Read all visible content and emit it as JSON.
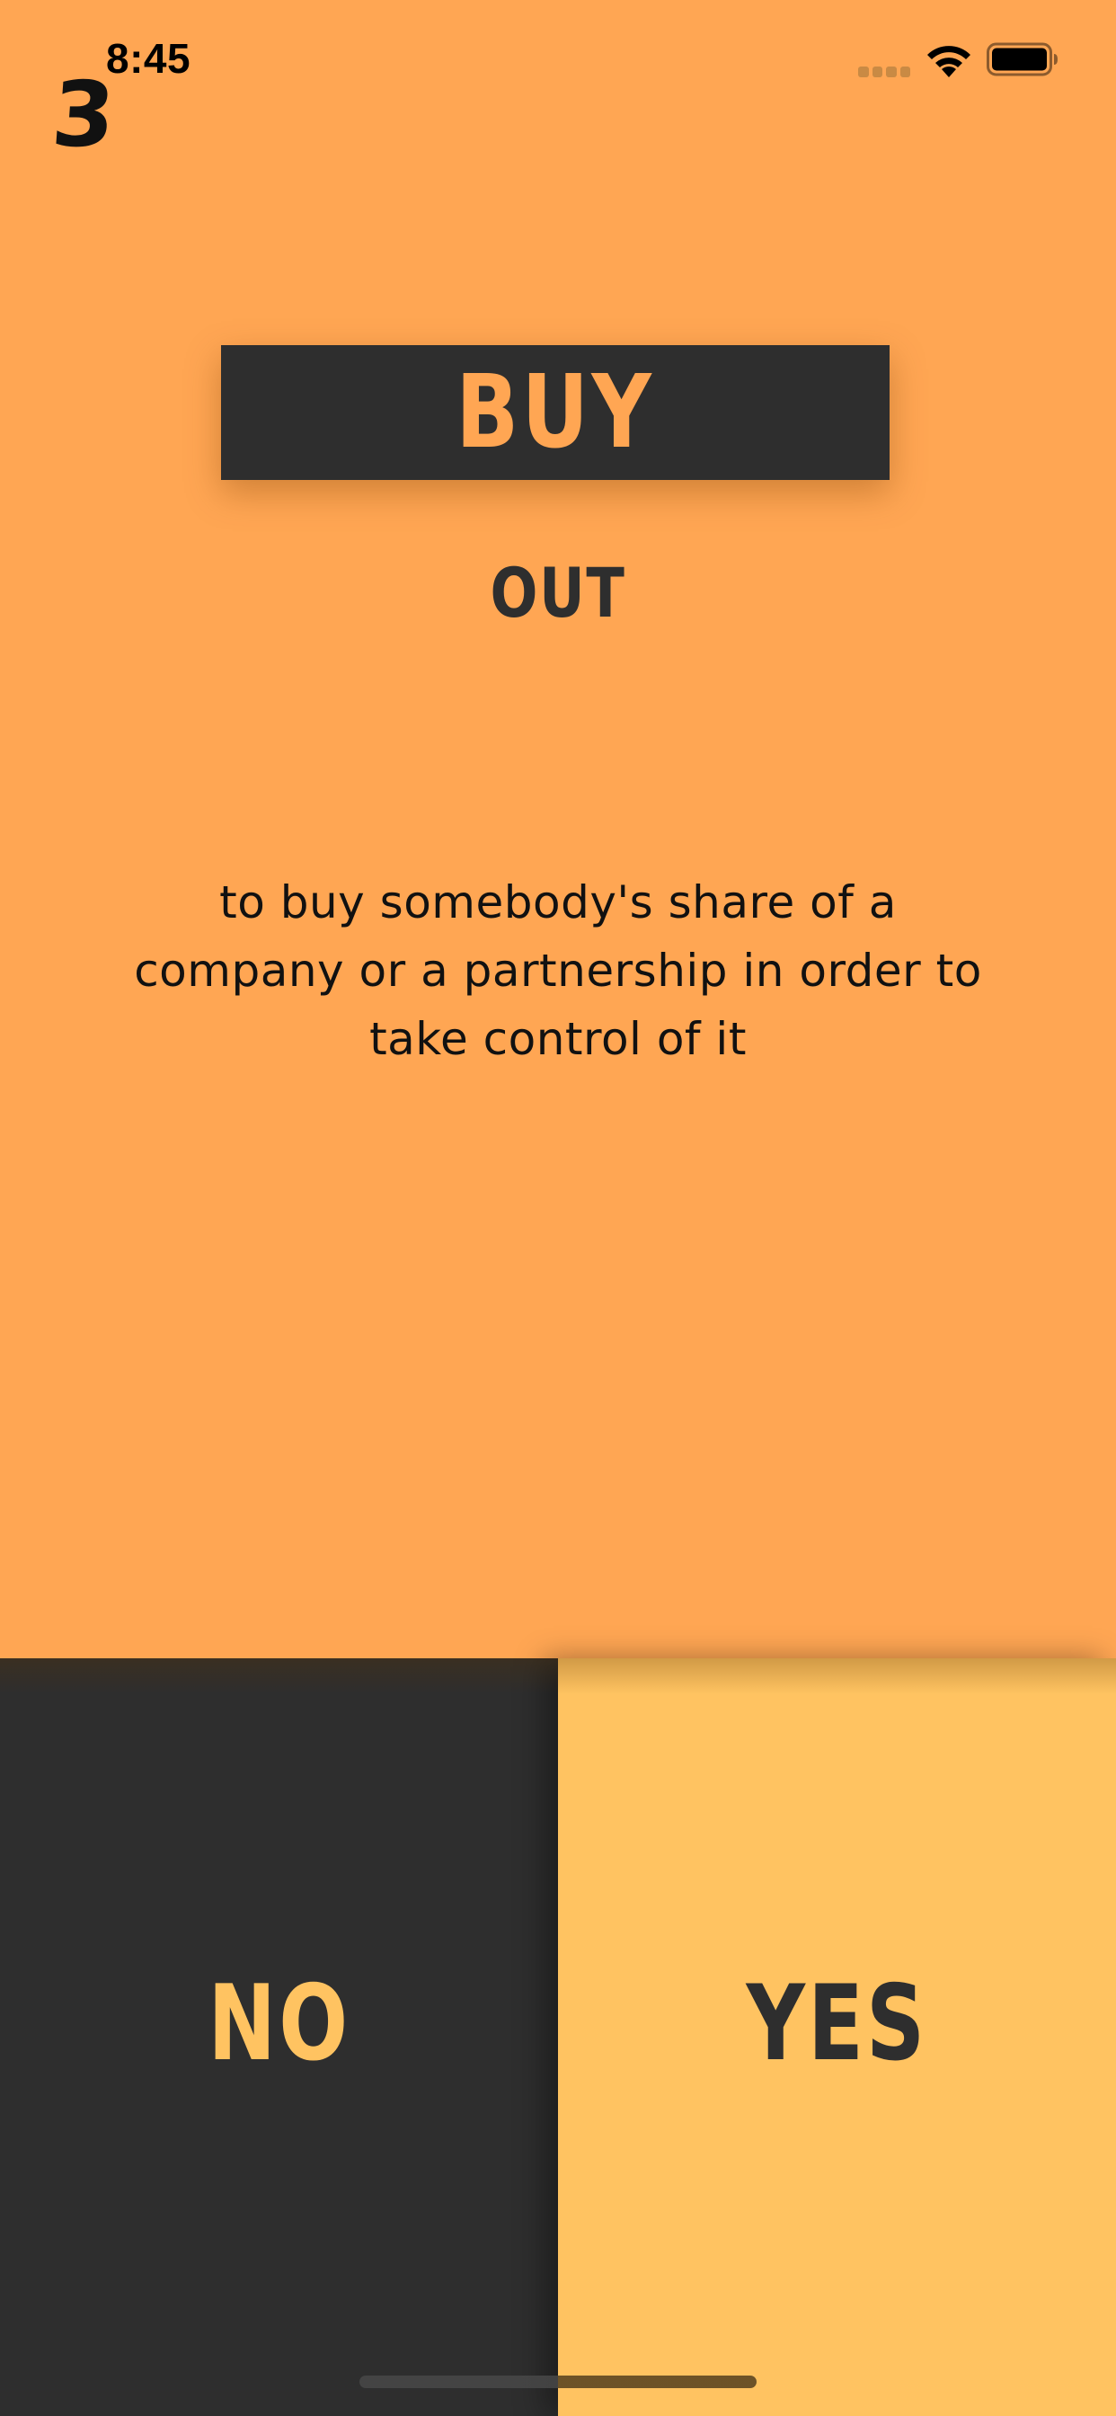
{
  "status_bar": {
    "time": "8:45"
  },
  "card": {
    "counter": "3",
    "word": "BUY",
    "particle": "OUT",
    "definition": "to buy somebody's share of a company or a partnership in order to take control of it"
  },
  "buttons": {
    "no_label": "NO",
    "yes_label": "YES"
  },
  "colors": {
    "background": "#FFA653",
    "dark": "#2E2E2E",
    "yes_background": "#FFC361"
  },
  "icons": {
    "signal": "cellular-signal-icon",
    "wifi": "wifi-icon",
    "battery": "battery-icon"
  }
}
